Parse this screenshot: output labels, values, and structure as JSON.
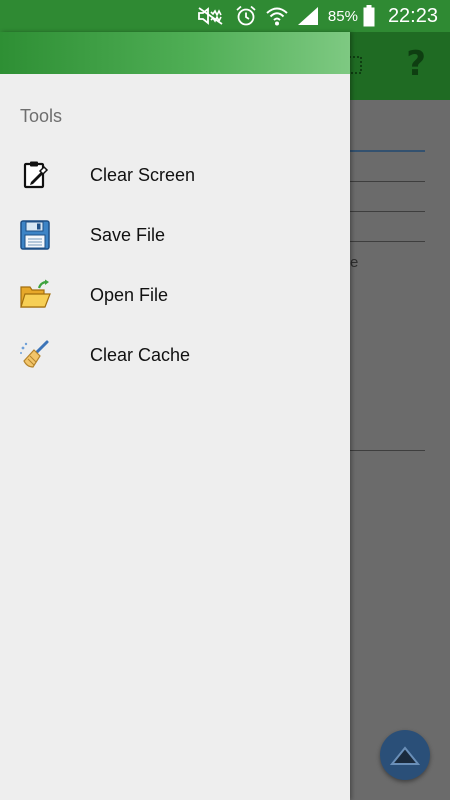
{
  "status_bar": {
    "battery": "85%",
    "time": "22:23",
    "icons": [
      "mute-icon",
      "alarm-icon",
      "wifi-icon",
      "signal-icon",
      "battery-icon"
    ]
  },
  "app_toolbar": {
    "help_label": "?",
    "icons": [
      "overflow-menu-icon",
      "help-icon"
    ]
  },
  "background": {
    "peek_text": "e"
  },
  "drawer": {
    "section_title": "Tools",
    "items": [
      {
        "label": "Clear Screen",
        "icon": "clipboard-clear-icon"
      },
      {
        "label": "Save File",
        "icon": "floppy-disk-icon"
      },
      {
        "label": "Open File",
        "icon": "open-folder-icon"
      },
      {
        "label": "Clear Cache",
        "icon": "broom-icon"
      }
    ]
  },
  "fab": {
    "icon": "scroll-up-icon"
  },
  "colors": {
    "status_bar": "#2f8a33",
    "drawer_header_start": "#2e8f34",
    "drawer_header_end": "#7ec982",
    "drawer_bg": "#eeeeee",
    "fab": "#2a4f78"
  }
}
